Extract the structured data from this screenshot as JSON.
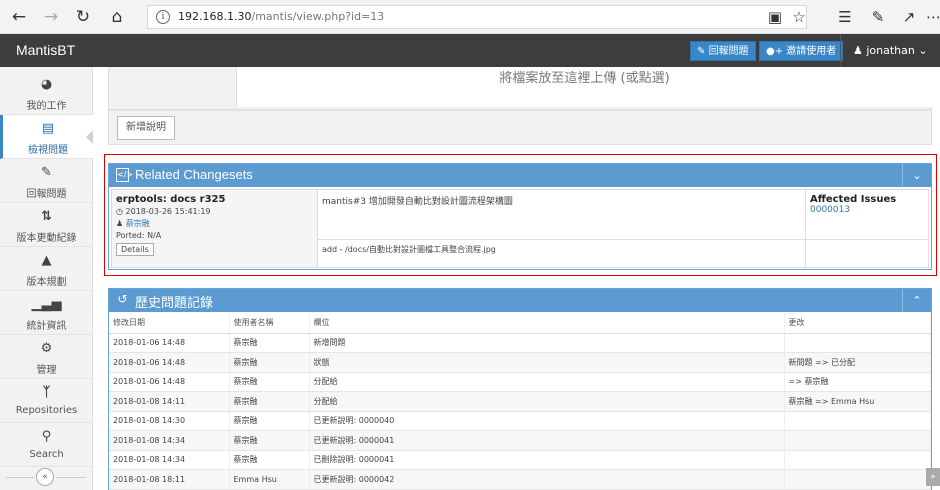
{
  "browser": {
    "url_host": "192.168.1.30",
    "url_path": "/mantis/view.php?id=13"
  },
  "app": {
    "brand": "MantisBT",
    "report_issue": "回報問題",
    "invite_users": "邀請使用者",
    "username": "jonathan"
  },
  "sidebar": {
    "items": [
      {
        "label": "我的工作"
      },
      {
        "label": "檢視問題"
      },
      {
        "label": "回報問題"
      },
      {
        "label": "版本更動紀錄"
      },
      {
        "label": "版本規劃"
      },
      {
        "label": "統計資訊"
      },
      {
        "label": "管理"
      },
      {
        "label": "Repositories"
      },
      {
        "label": "Search"
      }
    ]
  },
  "upload": {
    "drop_text": "將檔案放至這裡上傳 (或點選)",
    "add_note_button": "新增說明"
  },
  "changesets": {
    "title": "Related Changesets",
    "name": "erptools: docs r325",
    "timestamp": "2018-03-26 15:41:19",
    "author": "蔡宗融",
    "ported": "Ported: N/A",
    "details_button": "Details",
    "message": "mantis#3 增加開發自動比對設計圖流程架構圖",
    "file_change": "add - /docs/自動比對設計圖檔工具整合流程.jpg",
    "affected_header": "Affected Issues",
    "affected_issue": "0000013"
  },
  "history": {
    "title": "歷史問題記錄",
    "columns": [
      "修改日期",
      "使用者名稱",
      "欄位",
      "更改"
    ],
    "rows": [
      [
        "2018-01-06 14:48",
        "蔡宗融",
        "新增問題",
        ""
      ],
      [
        "2018-01-06 14:48",
        "蔡宗融",
        "狀態",
        "新問題 => 已分配"
      ],
      [
        "2018-01-06 14:48",
        "蔡宗融",
        "分配給",
        "=> 蔡宗融"
      ],
      [
        "2018-01-08 14:11",
        "蔡宗融",
        "分配給",
        "蔡宗融 => Emma Hsu"
      ],
      [
        "2018-01-08 14:30",
        "蔡宗融",
        "已更新說明: 0000040",
        ""
      ],
      [
        "2018-01-08 14:34",
        "蔡宗融",
        "已更新說明: 0000041",
        ""
      ],
      [
        "2018-01-08 14:34",
        "蔡宗融",
        "已刪除說明: 0000041",
        ""
      ],
      [
        "2018-01-08 18:11",
        "Emma Hsu",
        "已更新說明: 0000042",
        ""
      ]
    ]
  },
  "colors": {
    "accent": "#5b9bd1",
    "navbar": "#3d3d3d",
    "highlight_border": "#dd0000"
  }
}
